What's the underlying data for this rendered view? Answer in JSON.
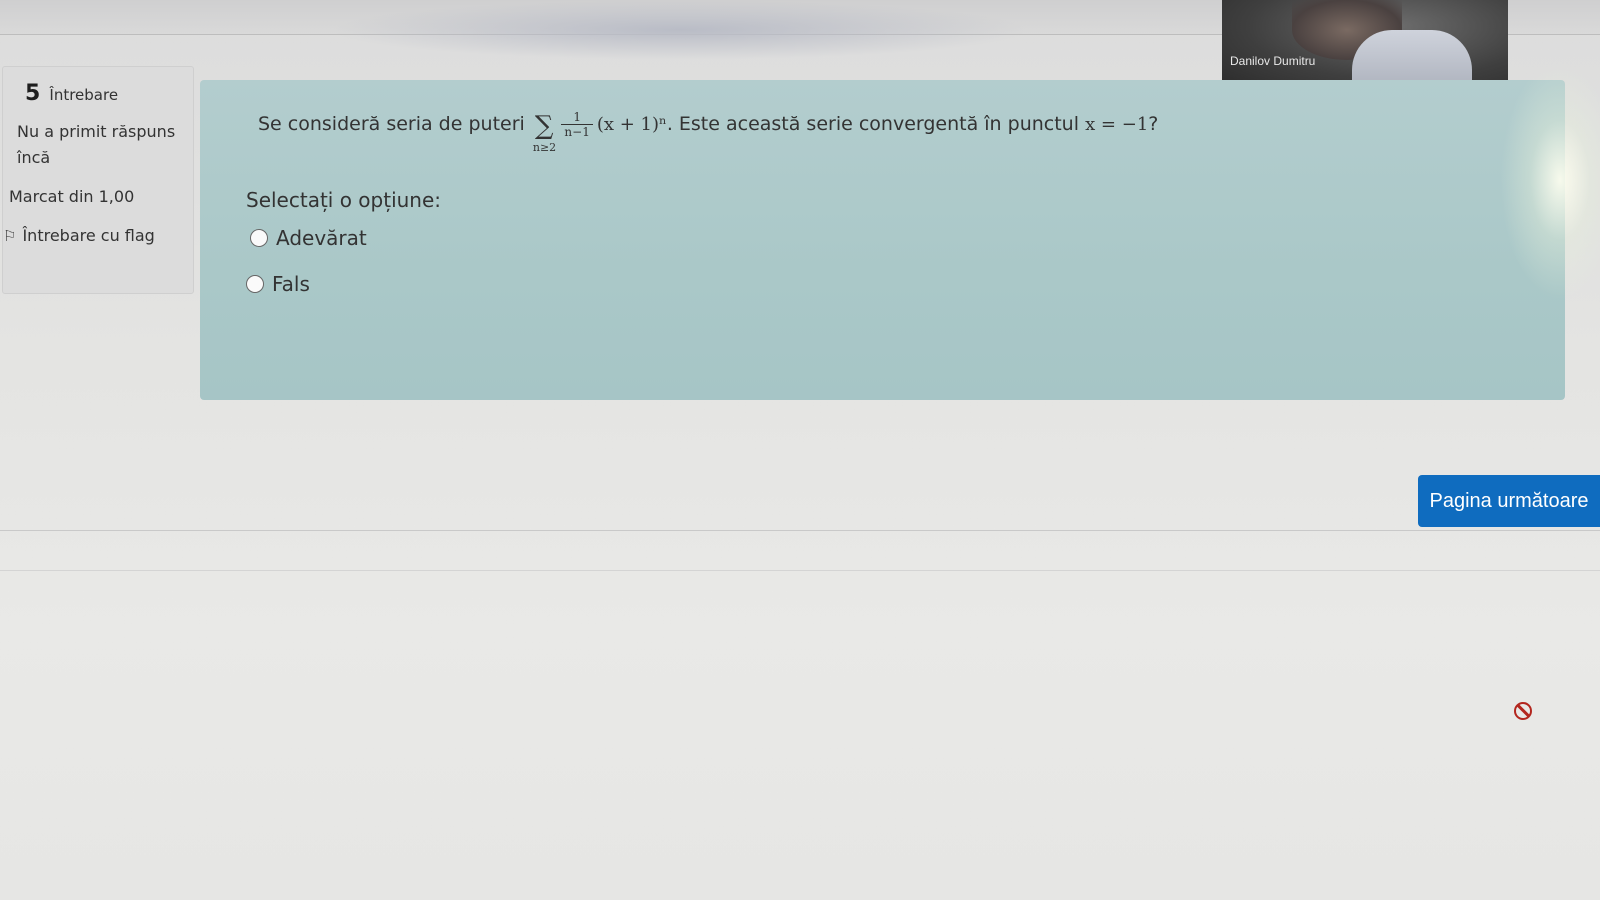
{
  "video": {
    "participant_name": "Danilov Dumitru"
  },
  "question_info": {
    "number": "5",
    "label": "Întrebare",
    "state": "Nu a primit răspuns încă",
    "grade": "Marcat din 1,00",
    "flag_label": "Întrebare cu flag",
    "flag_icon": "flag-icon"
  },
  "question": {
    "text_before": "Se consideră seria de puteri",
    "sum_symbol": "∑",
    "sum_index": "n≥2",
    "frac_num": "1",
    "frac_den": "n−1",
    "term": "(x + 1)ⁿ",
    "text_after": ". Este această serie convergentă în punctul",
    "point": "x = −1",
    "qmark": "?",
    "prompt": "Selectați o opțiune:",
    "options": [
      {
        "label": "Adevărat",
        "selected": false
      },
      {
        "label": "Fals",
        "selected": false
      }
    ]
  },
  "navigation": {
    "next_label": "Pagina următoare"
  },
  "colors": {
    "panel": "#aac8c8",
    "button": "#0f6cbf",
    "block_icon": "#b3261e"
  },
  "icons": {
    "block": "block-icon"
  }
}
